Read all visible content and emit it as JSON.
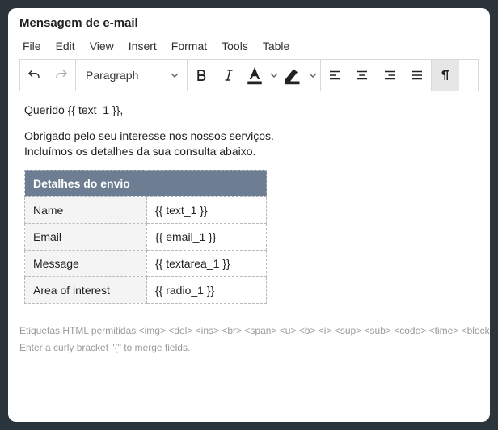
{
  "header": {
    "title": "Mensagem de e-mail"
  },
  "menubar": {
    "items": [
      "File",
      "Edit",
      "View",
      "Insert",
      "Format",
      "Tools",
      "Table"
    ]
  },
  "toolbar": {
    "paragraph_label": "Paragraph"
  },
  "editor": {
    "greeting": "Querido {{ text_1 }},",
    "body_line1": "Obrigado pelo seu interesse nos nossos serviços.",
    "body_line2": "Incluímos os detalhes da sua consulta abaixo.",
    "table": {
      "header": "Detalhes do envio",
      "rows": [
        {
          "label": "Name",
          "value": "{{ text_1 }}"
        },
        {
          "label": "Email",
          "value": "{{ email_1 }}"
        },
        {
          "label": "Message",
          "value": "{{ textarea_1 }}"
        },
        {
          "label": "Area of interest",
          "value": "{{ radio_1 }}"
        }
      ]
    }
  },
  "footer": {
    "allowed_label": "Etiquetas HTML permitidas",
    "tags": "<img> <del> <ins> <br> <span> <u> <b> <i> <sup> <sub> <code> <time> <blockquote> <pre> <hr> <p> <address> <table> <thead> <tbody> <tr> <th> <td>",
    "hint": "Enter a curly bracket \"{\" to merge fields."
  }
}
